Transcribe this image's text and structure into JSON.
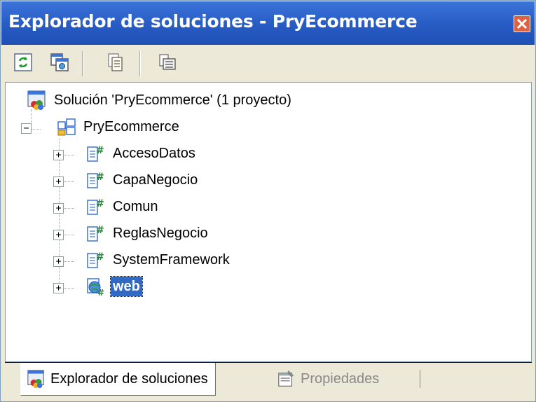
{
  "window": {
    "title": "Explorador de soluciones - PryEcommerce",
    "close_icon": "close-icon"
  },
  "toolbar": {
    "buttons": [
      {
        "name": "refresh-icon"
      },
      {
        "name": "show-all-files-icon"
      },
      {
        "name": "view-code-icon"
      },
      {
        "name": "properties-icon"
      }
    ]
  },
  "tree": {
    "solution": {
      "label": "Solución 'PryEcommerce' (1 proyecto)",
      "icon": "solution-icon"
    },
    "folder": {
      "label": "PryEcommerce",
      "icon": "solution-folder-icon",
      "expander": "−"
    },
    "projects": [
      {
        "label": "AccesoDatos",
        "icon": "csharp-project-icon",
        "expander": "+"
      },
      {
        "label": "CapaNegocio",
        "icon": "csharp-project-icon",
        "expander": "+"
      },
      {
        "label": "Comun",
        "icon": "csharp-project-icon",
        "expander": "+"
      },
      {
        "label": "ReglasNegocio",
        "icon": "csharp-project-icon",
        "expander": "+"
      },
      {
        "label": "SystemFramework",
        "icon": "csharp-project-icon",
        "expander": "+"
      },
      {
        "label": "web",
        "icon": "web-project-icon",
        "expander": "+",
        "selected": true
      }
    ]
  },
  "tabs": {
    "active": {
      "label": "Explorador de soluciones",
      "icon": "solution-icon"
    },
    "inactive": {
      "label": "Propiedades",
      "icon": "properties-icon"
    }
  },
  "colors": {
    "titlebar": "#2a5fc8",
    "selection": "#316ac5",
    "chrome": "#ece9d8"
  }
}
